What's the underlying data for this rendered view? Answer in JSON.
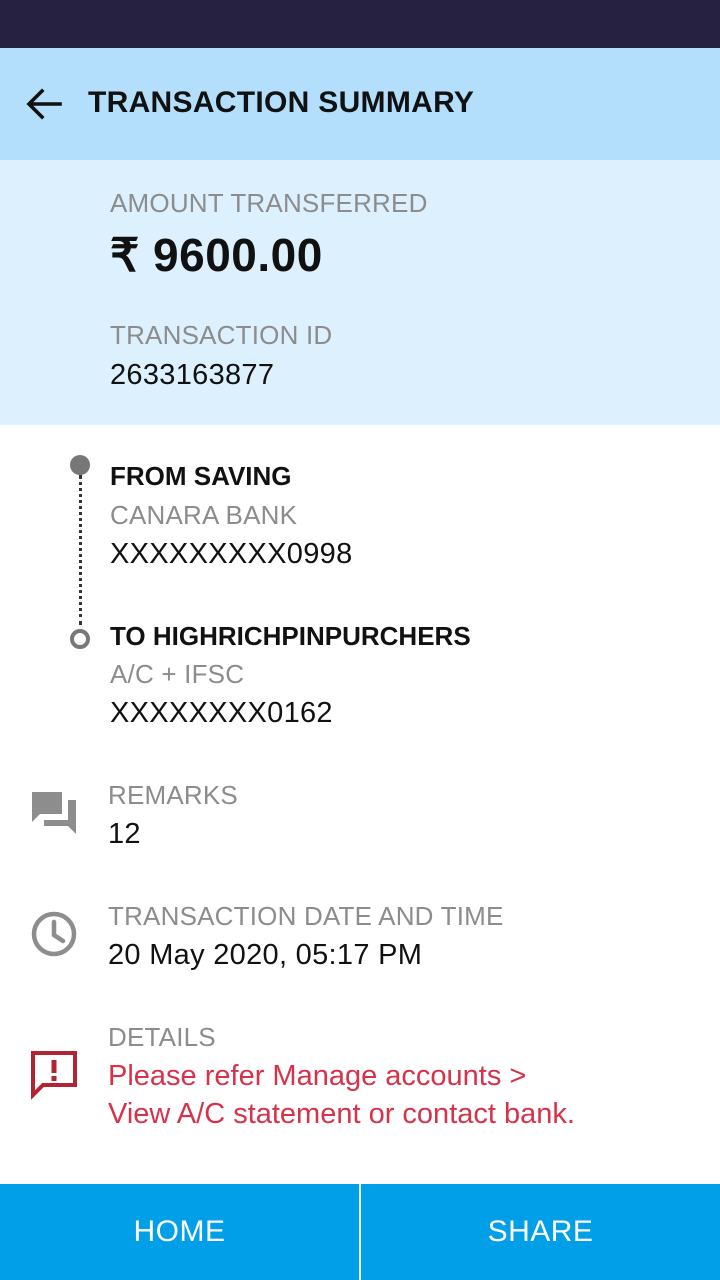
{
  "header": {
    "title": "TRANSACTION SUMMARY"
  },
  "summary": {
    "amount_label": "AMOUNT TRANSFERRED",
    "amount": "₹ 9600.00",
    "txn_id_label": "TRANSACTION ID",
    "txn_id": "2633163877"
  },
  "from": {
    "heading": "FROM SAVING",
    "bank": "CANARA BANK",
    "account": "XXXXXXXXX0998"
  },
  "to": {
    "heading": "TO HIGHRICHPINPURCHERS",
    "type": "A/C + IFSC",
    "account": "XXXXXXXX0162"
  },
  "remarks": {
    "label": "REMARKS",
    "value": "12",
    "icon": "chat-icon"
  },
  "datetime": {
    "label": "TRANSACTION DATE AND TIME",
    "value": "20 May 2020, 05:17 PM",
    "icon": "clock-icon"
  },
  "details": {
    "label": "DETAILS",
    "value": "Please refer Manage accounts >\n View A/C statement or contact bank.",
    "icon": "alert-message-icon"
  },
  "actions": {
    "home": "HOME",
    "share": "SHARE"
  },
  "colors": {
    "accent": "#029fe9",
    "header_bg": "#b3dffd",
    "summary_bg": "#dcf0fe",
    "alert": "#d6334a"
  }
}
